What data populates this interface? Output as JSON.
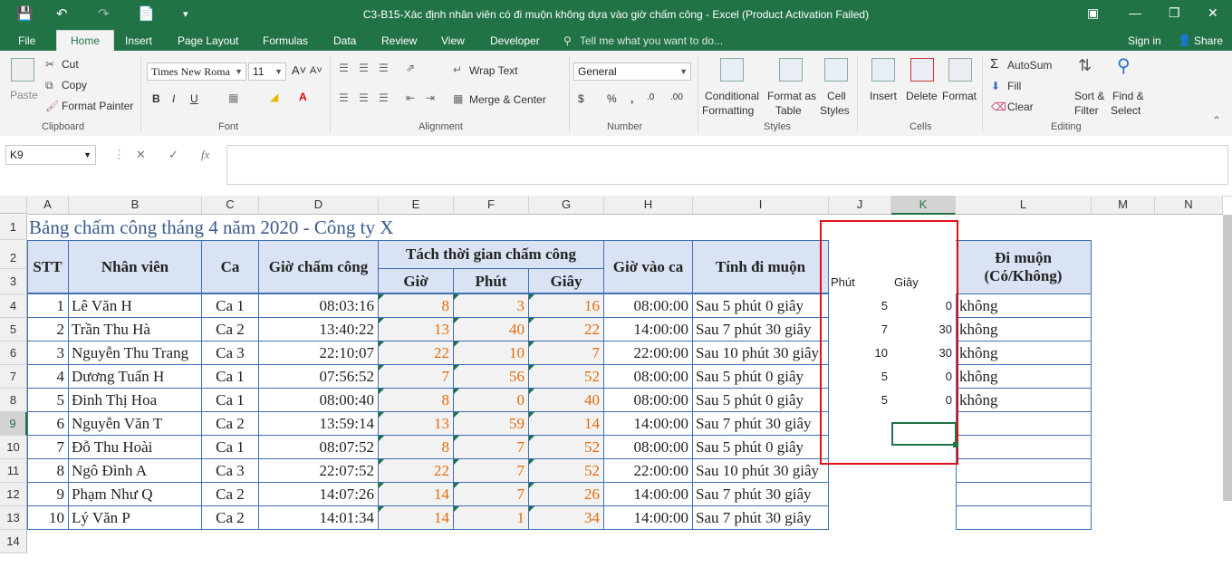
{
  "window": {
    "title": "C3-B15-Xác định nhân viên có đi muộn không dựa vào giờ chấm công - Excel (Product Activation Failed)"
  },
  "menu_tabs": [
    "File",
    "Home",
    "Insert",
    "Page Layout",
    "Formulas",
    "Data",
    "Review",
    "View",
    "Developer"
  ],
  "tell_me": "Tell me what you want to do...",
  "account": {
    "signin": "Sign in",
    "share": "Share"
  },
  "ribbon": {
    "clipboard": {
      "paste": "Paste",
      "cut": "Cut",
      "copy": "Copy",
      "format_painter": "Format Painter",
      "label": "Clipboard"
    },
    "font": {
      "name": "Times New Roma",
      "size": "11",
      "label": "Font"
    },
    "alignment": {
      "wrap": "Wrap Text",
      "merge": "Merge & Center",
      "label": "Alignment"
    },
    "number": {
      "format": "General",
      "label": "Number"
    },
    "styles": {
      "conditional": "Conditional",
      "conditional2": "Formatting",
      "format_as": "Format as",
      "format_as2": "Table",
      "cell": "Cell",
      "cell2": "Styles",
      "label": "Styles"
    },
    "cells": {
      "insert": "Insert",
      "delete": "Delete",
      "format": "Format",
      "label": "Cells"
    },
    "editing": {
      "autosum": "AutoSum",
      "fill": "Fill",
      "clear": "Clear",
      "sort": "Sort &",
      "sort2": "Filter",
      "find": "Find &",
      "find2": "Select",
      "label": "Editing"
    }
  },
  "formula_bar": {
    "name_box": "K9",
    "fx": "fx",
    "value": ""
  },
  "columns": [
    "A",
    "B",
    "C",
    "D",
    "E",
    "F",
    "G",
    "H",
    "I",
    "J",
    "K",
    "L",
    "M",
    "N"
  ],
  "rows": [
    "1",
    "2",
    "3",
    "4",
    "5",
    "6",
    "7",
    "8",
    "9",
    "10",
    "11",
    "12",
    "13",
    "14"
  ],
  "sheet": {
    "title": "Bảng chấm công tháng 4 năm 2020 - Công ty X",
    "headers": {
      "stt": "STT",
      "nhanvien": "Nhân viên",
      "ca": "Ca",
      "gio_cham_cong": "Giờ chấm công",
      "tach": "Tách thời gian chấm công",
      "gio": "Giờ",
      "phut": "Phút",
      "giay": "Giây",
      "gio_vao_ca": "Giờ vào ca",
      "tinh_di_muon": "Tính đi muộn",
      "j_phut": "Phút",
      "k_giay": "Giây",
      "di_muon": "Đi muộn",
      "di_muon2": "(Có/Không)"
    },
    "rows": [
      {
        "stt": "1",
        "nv": "Lê Văn H",
        "ca": "Ca 1",
        "gcc": "08:03:16",
        "gio": "8",
        "phut": "3",
        "giay": "16",
        "gvc": "08:00:00",
        "tdm": "Sau 5 phút 0 giây",
        "j": "5",
        "k": "0",
        "l": "không"
      },
      {
        "stt": "2",
        "nv": "Trần Thu Hà",
        "ca": "Ca 2",
        "gcc": "13:40:22",
        "gio": "13",
        "phut": "40",
        "giay": "22",
        "gvc": "14:00:00",
        "tdm": "Sau 7 phút 30 giây",
        "j": "7",
        "k": "30",
        "l": "không"
      },
      {
        "stt": "3",
        "nv": "Nguyễn Thu Trang",
        "ca": "Ca 3",
        "gcc": "22:10:07",
        "gio": "22",
        "phut": "10",
        "giay": "7",
        "gvc": "22:00:00",
        "tdm": "Sau 10 phút 30 giây",
        "j": "10",
        "k": "30",
        "l": "không"
      },
      {
        "stt": "4",
        "nv": "Dương Tuấn H",
        "ca": "Ca 1",
        "gcc": "07:56:52",
        "gio": "7",
        "phut": "56",
        "giay": "52",
        "gvc": "08:00:00",
        "tdm": "Sau 5 phút 0 giây",
        "j": "5",
        "k": "0",
        "l": "không"
      },
      {
        "stt": "5",
        "nv": "Đinh Thị Hoa",
        "ca": "Ca 1",
        "gcc": "08:00:40",
        "gio": "8",
        "phut": "0",
        "giay": "40",
        "gvc": "08:00:00",
        "tdm": "Sau 5 phút 0 giây",
        "j": "5",
        "k": "0",
        "l": "không"
      },
      {
        "stt": "6",
        "nv": "Nguyễn Văn T",
        "ca": "Ca 2",
        "gcc": "13:59:14",
        "gio": "13",
        "phut": "59",
        "giay": "14",
        "gvc": "14:00:00",
        "tdm": "Sau 7 phút 30 giây",
        "j": "",
        "k": "",
        "l": ""
      },
      {
        "stt": "7",
        "nv": "Đỗ Thu Hoài",
        "ca": "Ca 1",
        "gcc": "08:07:52",
        "gio": "8",
        "phut": "7",
        "giay": "52",
        "gvc": "08:00:00",
        "tdm": "Sau 5 phút 0 giây",
        "j": "",
        "k": "",
        "l": ""
      },
      {
        "stt": "8",
        "nv": "Ngô Đình A",
        "ca": "Ca 3",
        "gcc": "22:07:52",
        "gio": "22",
        "phut": "7",
        "giay": "52",
        "gvc": "22:00:00",
        "tdm": "Sau 10 phút 30 giây",
        "j": "",
        "k": "",
        "l": ""
      },
      {
        "stt": "9",
        "nv": "Phạm Như Q",
        "ca": "Ca 2",
        "gcc": "14:07:26",
        "gio": "14",
        "phut": "7",
        "giay": "26",
        "gvc": "14:00:00",
        "tdm": "Sau 7 phút 30 giây",
        "j": "",
        "k": "",
        "l": ""
      },
      {
        "stt": "10",
        "nv": "Lý Văn P",
        "ca": "Ca 2",
        "gcc": "14:01:34",
        "gio": "14",
        "phut": "1",
        "giay": "34",
        "gvc": "14:00:00",
        "tdm": "Sau 7 phút 30 giây",
        "j": "",
        "k": "",
        "l": ""
      }
    ]
  },
  "colors": {
    "excel_green": "#217346",
    "header_fill": "#dae3f3",
    "border_blue": "#3f6fb5",
    "orange": "#e46c0a",
    "highlight_red": "#e0101a"
  }
}
